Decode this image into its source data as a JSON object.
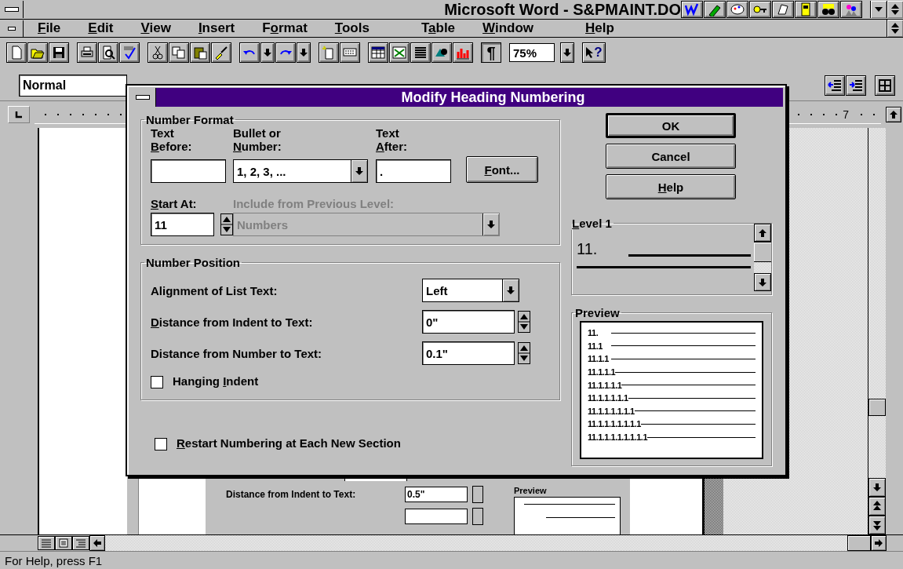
{
  "window": {
    "title": "Microsoft Word - S&PMAINT.DO"
  },
  "menu": [
    {
      "key": "F",
      "post": "ile"
    },
    {
      "key": "E",
      "post": "dit"
    },
    {
      "key": "V",
      "post": "iew"
    },
    {
      "key": "I",
      "post": "nsert"
    },
    {
      "pre": "F",
      "key": "o",
      "post": "rmat"
    },
    {
      "key": "T",
      "post": "ools"
    },
    {
      "pre": "T",
      "key": "a",
      "post": "ble"
    },
    {
      "key": "W",
      "post": "indow"
    },
    {
      "key": "H",
      "post": "elp"
    }
  ],
  "toolbar": {
    "pilcrow": "¶",
    "zoom": "75%",
    "help_mark": "?"
  },
  "formatting": {
    "style": "Normal"
  },
  "ruler": {
    "number": "7"
  },
  "dialog": {
    "title": "Modify Heading Numbering",
    "number_format": {
      "legend": "Number Format",
      "text_before": {
        "line1": "Text",
        "label": {
          "key": "B",
          "post": "efore:"
        }
      },
      "bullet": {
        "line1": "Bullet or",
        "label": {
          "key": "N",
          "post": "umber:"
        },
        "value": "1, 2, 3, ..."
      },
      "text_after": {
        "line1": "Text",
        "label": {
          "key": "A",
          "post": "fter:"
        },
        "value": "."
      },
      "font_button": {
        "key": "F",
        "post": "ont..."
      },
      "start_at": {
        "label": {
          "key": "S",
          "post": "tart At:"
        },
        "value": "11"
      },
      "include": {
        "label": "Include from Previous Level:",
        "value": "Numbers",
        "disabled": true
      }
    },
    "number_position": {
      "legend": "Number Position",
      "alignment": {
        "label": "Alignment of List Text:",
        "value": "Left"
      },
      "indent_distance": {
        "label": {
          "key": "D",
          "post": "istance from Indent to Text:"
        },
        "value": "0\""
      },
      "number_distance": {
        "label": "Distance from Number to Text:",
        "value": "0.1\""
      },
      "hanging_indent": {
        "label": {
          "pre": "Hanging ",
          "key": "I",
          "post": "ndent"
        },
        "checked": false
      }
    },
    "restart": {
      "label": {
        "key": "R",
        "post": "estart Numbering at Each New Section"
      },
      "checked": false
    },
    "buttons": [
      {
        "label": {
          "pre": "OK"
        },
        "default": true
      },
      {
        "label": {
          "pre": "Cancel"
        },
        "default": false
      },
      {
        "label": {
          "key": "H",
          "post": "elp"
        },
        "default": false
      }
    ],
    "level": {
      "legend": {
        "key": "L",
        "post": "evel 1"
      },
      "sample": "11."
    },
    "preview": {
      "legend": "Preview",
      "lines": [
        "11.",
        "11.1",
        "11.1.1",
        "11.1.1.1",
        "11.1.1.1.1",
        "11.1.1.1.1.1",
        "11.1.1.1.1.1.1",
        "11.1.1.1.1.1.1.1",
        "11.1.1.1.1.1.1.1.1"
      ]
    }
  },
  "page_picture": {
    "label": "Distance from Indent to Text:",
    "value": "0.5\"",
    "preview_legend": "Preview"
  },
  "status_bar": "For Help, press F1"
}
